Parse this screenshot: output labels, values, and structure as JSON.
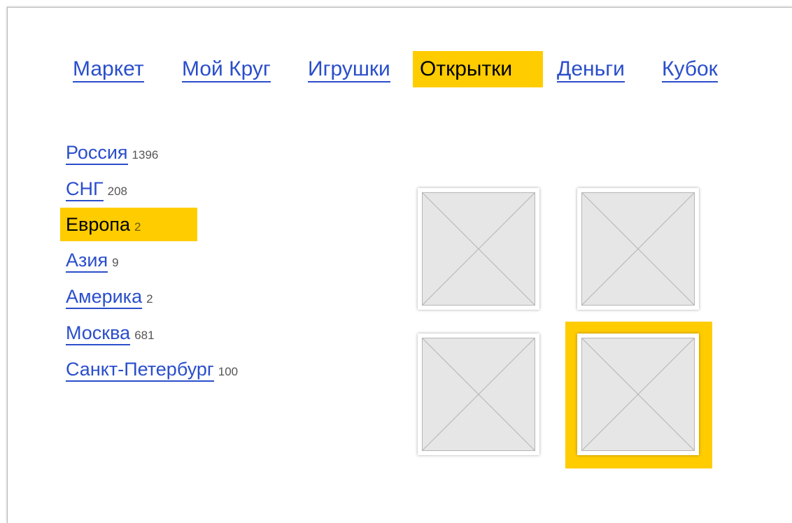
{
  "colors": {
    "link": "#2a4ecb",
    "highlight": "#ffcc00",
    "count": "#555555",
    "placeholder_fill": "#e6e6e6",
    "placeholder_line": "#b5b5b5"
  },
  "topnav": {
    "items": [
      {
        "label": "Маркет",
        "active": false
      },
      {
        "label": "Мой Круг",
        "active": false
      },
      {
        "label": "Игрушки",
        "active": false
      },
      {
        "label": "Открытки",
        "active": true
      },
      {
        "label": "Деньги",
        "active": false
      },
      {
        "label": "Кубок",
        "active": false
      }
    ]
  },
  "regions": {
    "items": [
      {
        "name": "Россия",
        "count": "1396",
        "active": false
      },
      {
        "name": "СНГ",
        "count": "208",
        "active": false
      },
      {
        "name": "Европа",
        "count": "2",
        "active": true
      },
      {
        "name": "Азия",
        "count": "9",
        "active": false
      },
      {
        "name": "Америка",
        "count": "2",
        "active": false
      },
      {
        "name": "Москва",
        "count": "681",
        "active": false
      },
      {
        "name": "Санкт-Петербург",
        "count": "100",
        "active": false
      }
    ]
  },
  "thumbnails": {
    "items": [
      {
        "icon": "image-placeholder-icon",
        "active": false
      },
      {
        "icon": "image-placeholder-icon",
        "active": false
      },
      {
        "icon": "image-placeholder-icon",
        "active": false
      },
      {
        "icon": "image-placeholder-icon",
        "active": true
      }
    ]
  }
}
